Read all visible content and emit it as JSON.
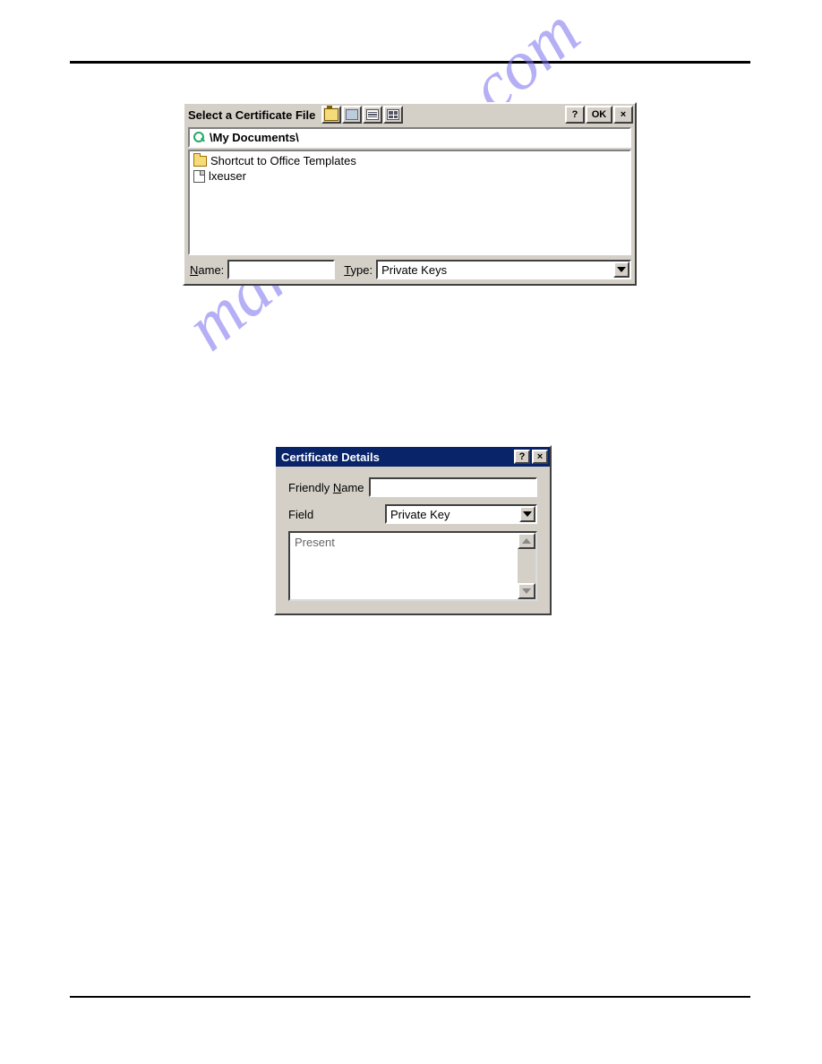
{
  "watermark": "manualshive.com",
  "dialog1": {
    "title": "Select a Certificate File",
    "path": "\\My Documents\\",
    "items": [
      {
        "icon": "folder",
        "label": "Shortcut to Office Templates"
      },
      {
        "icon": "file",
        "label": "lxeuser"
      }
    ],
    "name_label": "Name:",
    "name_value": "",
    "type_label": "Type:",
    "type_value": "Private Keys",
    "buttons": {
      "ok": "OK",
      "help": "?",
      "close": "×"
    }
  },
  "dialog2": {
    "title": "Certificate Details",
    "friendly_name_label": "Friendly Name",
    "friendly_name_value": "",
    "field_label": "Field",
    "field_value": "Private Key",
    "textarea_value": "Present",
    "buttons": {
      "help": "?",
      "close": "×"
    }
  }
}
